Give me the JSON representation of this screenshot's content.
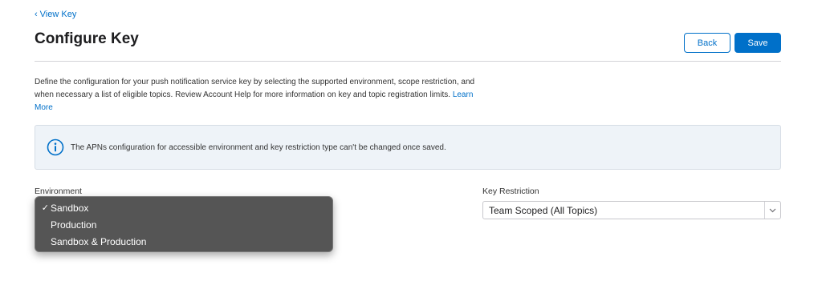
{
  "nav": {
    "back_link_chevron": "‹",
    "back_link_label": "View Key"
  },
  "header": {
    "title": "Configure Key",
    "back_button": "Back",
    "save_button": "Save"
  },
  "description": {
    "text": "Define the configuration for your push notification service key by selecting the supported environment, scope restriction, and when necessary a list of eligible topics. Review Account Help for more information on key and topic registration limits.",
    "learn_more": "Learn More"
  },
  "info": {
    "icon": "info-circle-icon",
    "message": "The APNs configuration for accessible environment and key restriction type can't be changed once saved."
  },
  "environment": {
    "label": "Environment",
    "options": [
      {
        "label": "Sandbox",
        "check": "✓"
      },
      {
        "label": "Production",
        "check": ""
      },
      {
        "label": "Sandbox & Production",
        "check": ""
      }
    ]
  },
  "key_restriction": {
    "label": "Key Restriction",
    "value": "Team Scoped (All Topics)"
  },
  "colors": {
    "accent": "#0070c9",
    "menu_bg": "#555555",
    "info_bg": "#eef3f8"
  }
}
